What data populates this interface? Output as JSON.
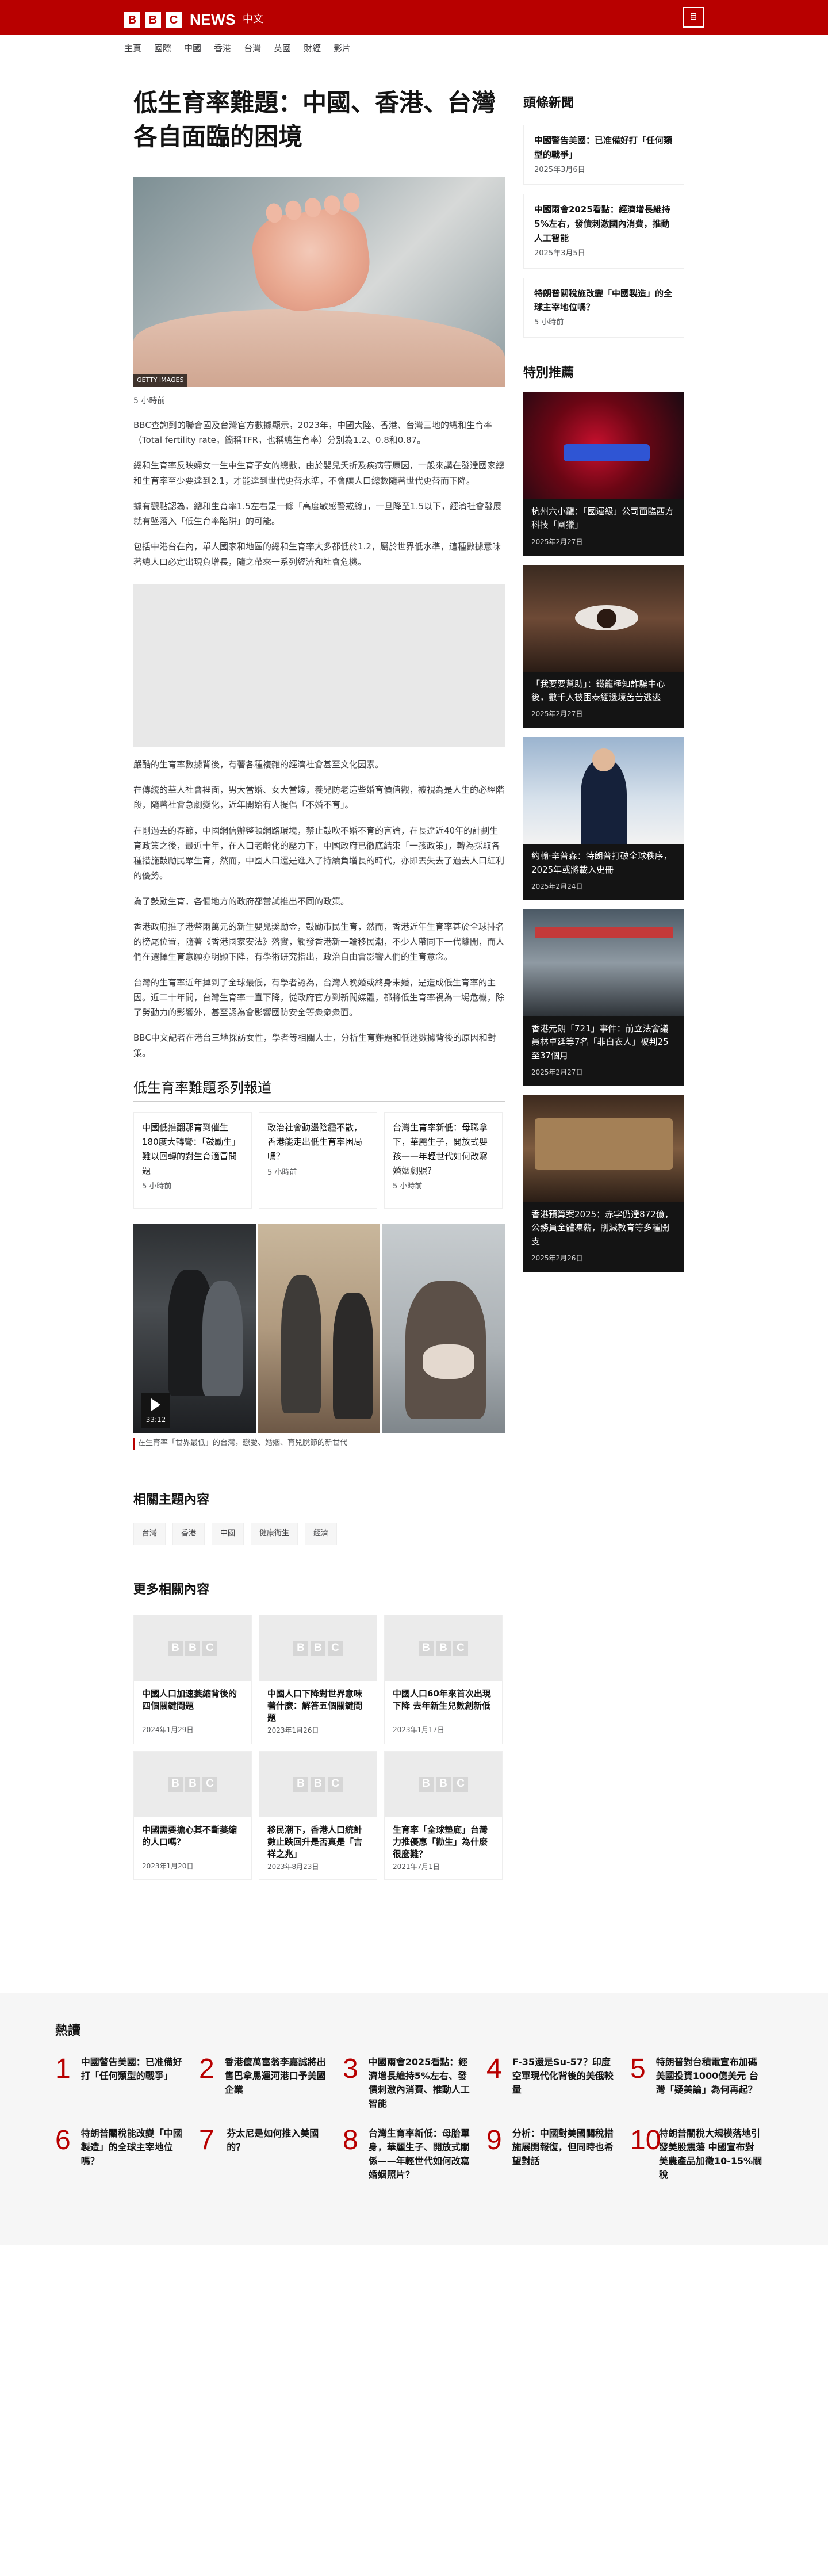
{
  "header": {
    "brand_letters": [
      "B",
      "B",
      "C"
    ],
    "brand_news": "NEWS",
    "brand_lang": "中文",
    "menu_label": "目"
  },
  "nav": [
    "主頁",
    "國際",
    "中國",
    "香港",
    "台灣",
    "英國",
    "財經",
    "影片"
  ],
  "article": {
    "headline": "低生育率難題：中國、香港、台灣各自面臨的困境",
    "image_credit": "GETTY IMAGES",
    "timestamp": "5 小時前",
    "p1_a": "BBC查詢到的",
    "p1_link1": "聯合國",
    "p1_b": "及",
    "p1_link2": "台灣官方數據",
    "p1_c": "顯示，2023年，中國大陸、香港、台灣三地的總和生育率（Total fertility rate，簡稱TFR，也稱總生育率）分別為1.2、0.8和0.87。",
    "p2": "總和生育率反映婦女一生中生育子女的總數，由於嬰兒夭折及疾病等原因，一般來講在發達國家總和生育率至少要達到2.1，才能達到世代更替水準，不會讓人口總數隨著世代更替而下降。",
    "p3": "據有觀點認為，總和生育率1.5左右是一條「高度敏感警戒線」，一旦降至1.5以下，經濟社會發展就有墜落入「低生育率陷阱」的可能。",
    "p4": "包括中港台在內，單人國家和地區的總和生育率大多都低於1.2，屬於世界低水準，這種數據意味著總人口必定出現負增長，隨之帶來一系列經濟和社會危機。",
    "p5": "嚴酷的生育率數據背後，有著各種複雜的經濟社會甚至文化因素。",
    "p6": "在傳統的華人社會裡面，男大當婚、女大當嫁，養兒防老這些婚育價值觀，被視為是人生的必經階段，隨著社會急劇變化，近年開始有人提倡「不婚不育」。",
    "p7": "在剛過去的春節，中國網信辦整頓網路環境，禁止鼓吹不婚不育的言論，在長達近40年的計劃生育政策之後，最近十年，在人口老齡化的壓力下，中國政府已徹底結束「一孩政策」，轉為採取各種措施鼓勵民眾生育，然而，中國人口還是進入了持續負增長的時代，亦即丟失去了過去人口紅利的優勢。",
    "p8": "為了鼓勵生育，各個地方的政府都嘗試推出不同的政策。",
    "p9": "香港政府推了港幣兩萬元的新生嬰兒獎勵金，鼓勵市民生育，然而，香港近年生育率甚於全球排名的榜尾位置，隨著《香港國家安法》落實，觸發香港新一輪移民潮，不少人帶同下一代離開，而人們在選擇生育意願亦明顯下降，有學術研究指出，政治自由會影響人們的生育意念。",
    "p10": "台灣的生育率近年掉到了全球最低，有學者認為，台灣人晚婚或終身未婚，是造成低生育率的主因。近二十年間，台灣生育率一直下降，從政府官方到新聞媒體，都將低生育率視為一場危機，除了勞動力的影響外，甚至認為會影響國防安全等衆衆衆面。",
    "p11": "BBC中文記者在港台三地採訪女性，學者等相關人士，分析生育難題和低迷數據背後的原因和對策。",
    "series_title": "低生育率難題系列報道",
    "series": [
      {
        "title": "中國低推翻那育到催生180度大轉彎：「鼓勵生」難以回轉的對生育適冒問題",
        "date": "5 小時前"
      },
      {
        "title": "政治社會動盪陰霾不散，香港能走出低生育率困局嗎？",
        "date": "5 小時前"
      },
      {
        "title": "台灣生育率新低：母職拿下，華麗生子，開放式嬰孩——年輕世代如何改寫婚姻劇照？",
        "date": "5 小時前"
      }
    ],
    "video_duration": "33:12",
    "video_caption": "在生育率「世界最低」的台灣，戀愛、婚姻、育兒脫節的新世代"
  },
  "related_topics": {
    "title": "相關主題內容",
    "tags": [
      "台灣",
      "香港",
      "中國",
      "健康衛生",
      "經濟"
    ]
  },
  "more": {
    "title": "更多相關內容",
    "placeholder_letters": [
      "B",
      "B",
      "C"
    ],
    "items": [
      {
        "title": "中國人口加速萎縮背後的四個關鍵問題",
        "date": "2024年1月29日"
      },
      {
        "title": "中國人口下降對世界意味著什麼：解答五個關鍵問題",
        "date": "2023年1月26日"
      },
      {
        "title": "中國人口60年來首次出現下降 去年新生兒數創新低",
        "date": "2023年1月17日"
      },
      {
        "title": "中國需要擔心其不斷萎縮的人口嗎？",
        "date": "2023年1月20日"
      },
      {
        "title": "移民潮下，香港人口統計數止跌回升是否真是「吉祥之兆」",
        "date": "2023年8月23日"
      },
      {
        "title": "生育率「全球墊底」台灣力推優惠「勸生」為什麼很麼難？",
        "date": "2021年7月1日"
      }
    ]
  },
  "sidebar": {
    "top_title": "頭條新聞",
    "top_stories": [
      {
        "title": "中國警告美國：已准備好打「任何類型的戰爭」",
        "date": "2025年3月6日"
      },
      {
        "title": "中國兩會2025看點：經濟增長維持5%左右，發債刺激國內消費，推動人工智能",
        "date": "2025年3月5日"
      },
      {
        "title": "特朗普關稅施改變「中國製造」的全球主宰地位嗎？",
        "date": "5 小時前"
      }
    ],
    "featured_title": "特別推薦",
    "featured": [
      {
        "title": "杭州六小龍：「國運級」公司面臨西方科技「圍獵」",
        "date": "2025年2月27日"
      },
      {
        "title": "「我要要幫助」：鐵籠極知詐騙中心後，數千人被困泰緬邊境苦苦逃逃",
        "date": "2025年2月27日"
      },
      {
        "title": "約翰·辛普森：特朗普打破全球秩序，2025年或將載入史冊",
        "date": "2025年2月24日"
      },
      {
        "title": "香港元朗「721」事件：前立法會議員林卓廷等7名「非白衣人」被判25至37個月",
        "date": "2025年2月27日"
      },
      {
        "title": "香港預算案2025：赤字仍達872億，公務員全體凍薪，削減教育等多種開支",
        "date": "2025年2月26日"
      }
    ]
  },
  "popular": {
    "title": "熱讀",
    "items": [
      {
        "n": "1",
        "title": "中國警告美國：已准備好打「任何類型的戰爭」"
      },
      {
        "n": "2",
        "title": "香港億萬富翁李嘉誠將出售巴拿馬運河港口予美國企業"
      },
      {
        "n": "3",
        "title": "中國兩會2025看點：經濟增長維持5%左右、發債刺激內消費、推動人工智能"
      },
      {
        "n": "4",
        "title": "F-35還是Su-57？印度空軍現代化背後的美俄較量"
      },
      {
        "n": "5",
        "title": "特朗普對台積電宣布加碼美國投資1000億美元 台灣「疑美論」為何再起？"
      },
      {
        "n": "6",
        "title": "特朗普關稅能改變「中國製造」的全球主宰地位嗎？"
      },
      {
        "n": "7",
        "title": "芬太尼是如何推入美國的？"
      },
      {
        "n": "8",
        "title": "台灣生育率新低：母胎單身，華麗生子、開放式關係——年輕世代如何改寫婚姻照片？"
      },
      {
        "n": "9",
        "title": "分析：中國對美國關稅措施展開報復，但同時也希望對話"
      },
      {
        "n": "10",
        "title": "特朗普關稅大規模落地引發美股震蕩 中國宣布對美農產品加徵10-15%關稅"
      }
    ]
  },
  "colors": {
    "brand_red": "#b80000",
    "text": "#141414",
    "muted": "#545658",
    "panel": "#f6f6f6"
  }
}
